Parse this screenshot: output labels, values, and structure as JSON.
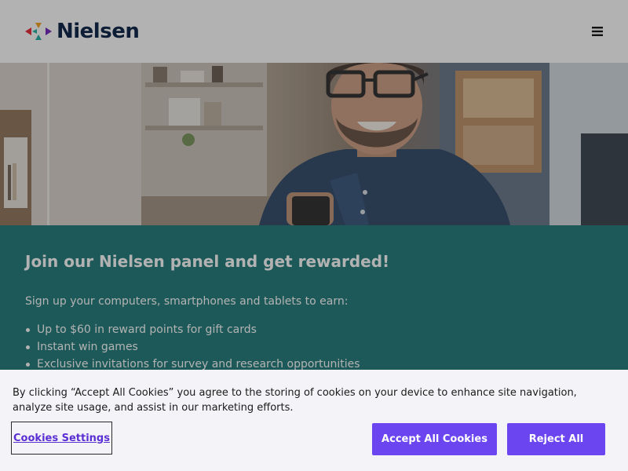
{
  "header": {
    "brand_name": "Nielsen",
    "logo_colors": [
      "#7a2fbf",
      "#e8323c",
      "#f5a623",
      "#2ab3a6"
    ],
    "menu_icon": "hamburger-icon"
  },
  "hero": {
    "image_subject": "man-smiling-at-phone-photo"
  },
  "promo": {
    "title": "Join our Nielsen panel and get rewarded!",
    "intro": "Sign up your computers, smartphones and tablets to earn:",
    "benefits": [
      "Up to $60 in reward points for gift cards",
      "Instant win games",
      "Exclusive invitations for survey and research opportunities"
    ],
    "background_color": "#2a8080"
  },
  "cookie_banner": {
    "text": "By clicking “Accept All Cookies” you agree to the storing of cookies on your device to enhance site navigation, analyze site usage, and assist in our marketing efforts.",
    "settings_label": "Cookies Settings",
    "accept_label": "Accept All Cookies",
    "reject_label": "Reject All",
    "button_color": "#6b45f0"
  }
}
